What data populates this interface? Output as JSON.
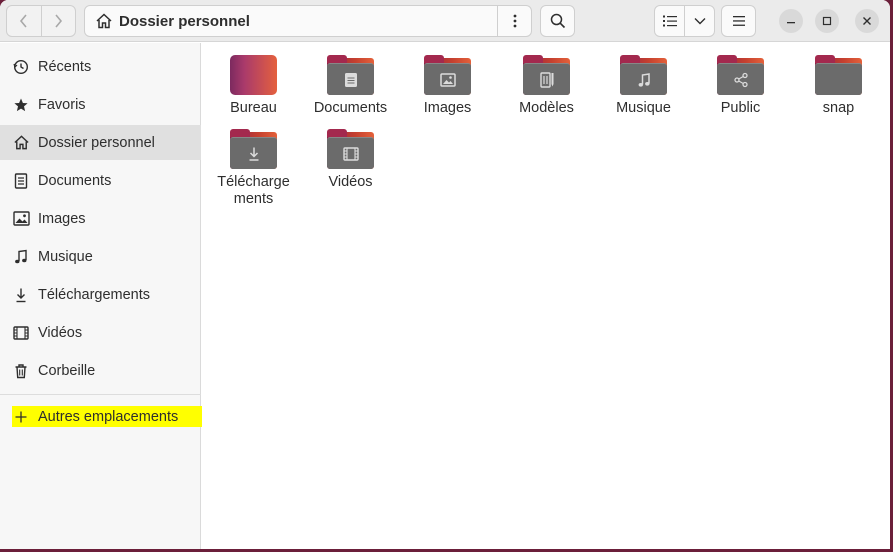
{
  "header": {
    "path_label": "Dossier personnel",
    "icons": {
      "back": "chevron-left-icon",
      "forward": "chevron-right-icon",
      "home": "home-icon",
      "path_menu": "vertical-dots-icon",
      "search": "search-icon",
      "list_view": "list-view-icon",
      "view_options": "chevron-down-icon",
      "main_menu": "hamburger-menu-icon",
      "minimize": "minimize-icon",
      "maximize": "maximize-icon",
      "close": "close-icon"
    }
  },
  "sidebar": {
    "items": [
      {
        "label": "Récents",
        "icon": "clock-icon"
      },
      {
        "label": "Favoris",
        "icon": "star-icon"
      },
      {
        "label": "Dossier personnel",
        "icon": "home-icon",
        "active": true
      },
      {
        "label": "Documents",
        "icon": "document-icon"
      },
      {
        "label": "Images",
        "icon": "image-icon"
      },
      {
        "label": "Musique",
        "icon": "music-icon"
      },
      {
        "label": "Téléchargements",
        "icon": "download-icon"
      },
      {
        "label": "Vidéos",
        "icon": "video-icon"
      },
      {
        "label": "Corbeille",
        "icon": "trash-icon"
      }
    ],
    "other_locations": {
      "label": "Autres emplacements",
      "icon": "plus-icon",
      "highlight_color": "#ffff00"
    }
  },
  "folders": [
    {
      "name": "Bureau",
      "icon": "desktop-icon"
    },
    {
      "name": "Documents",
      "icon": "document-icon"
    },
    {
      "name": "Images",
      "icon": "image-icon"
    },
    {
      "name": "Modèles",
      "icon": "template-icon"
    },
    {
      "name": "Musique",
      "icon": "music-icon"
    },
    {
      "name": "Public",
      "icon": "share-icon"
    },
    {
      "name": "snap",
      "icon": "folder-icon"
    },
    {
      "name": "Téléchargements",
      "display": "Télécharge\nments",
      "icon": "download-icon"
    },
    {
      "name": "Vidéos",
      "icon": "video-icon"
    }
  ],
  "colors": {
    "accent": "#e95420",
    "folder_gray": "#6b6b6b",
    "folder_back": "#a3294e",
    "desktop_background": "#6b1f3a"
  }
}
